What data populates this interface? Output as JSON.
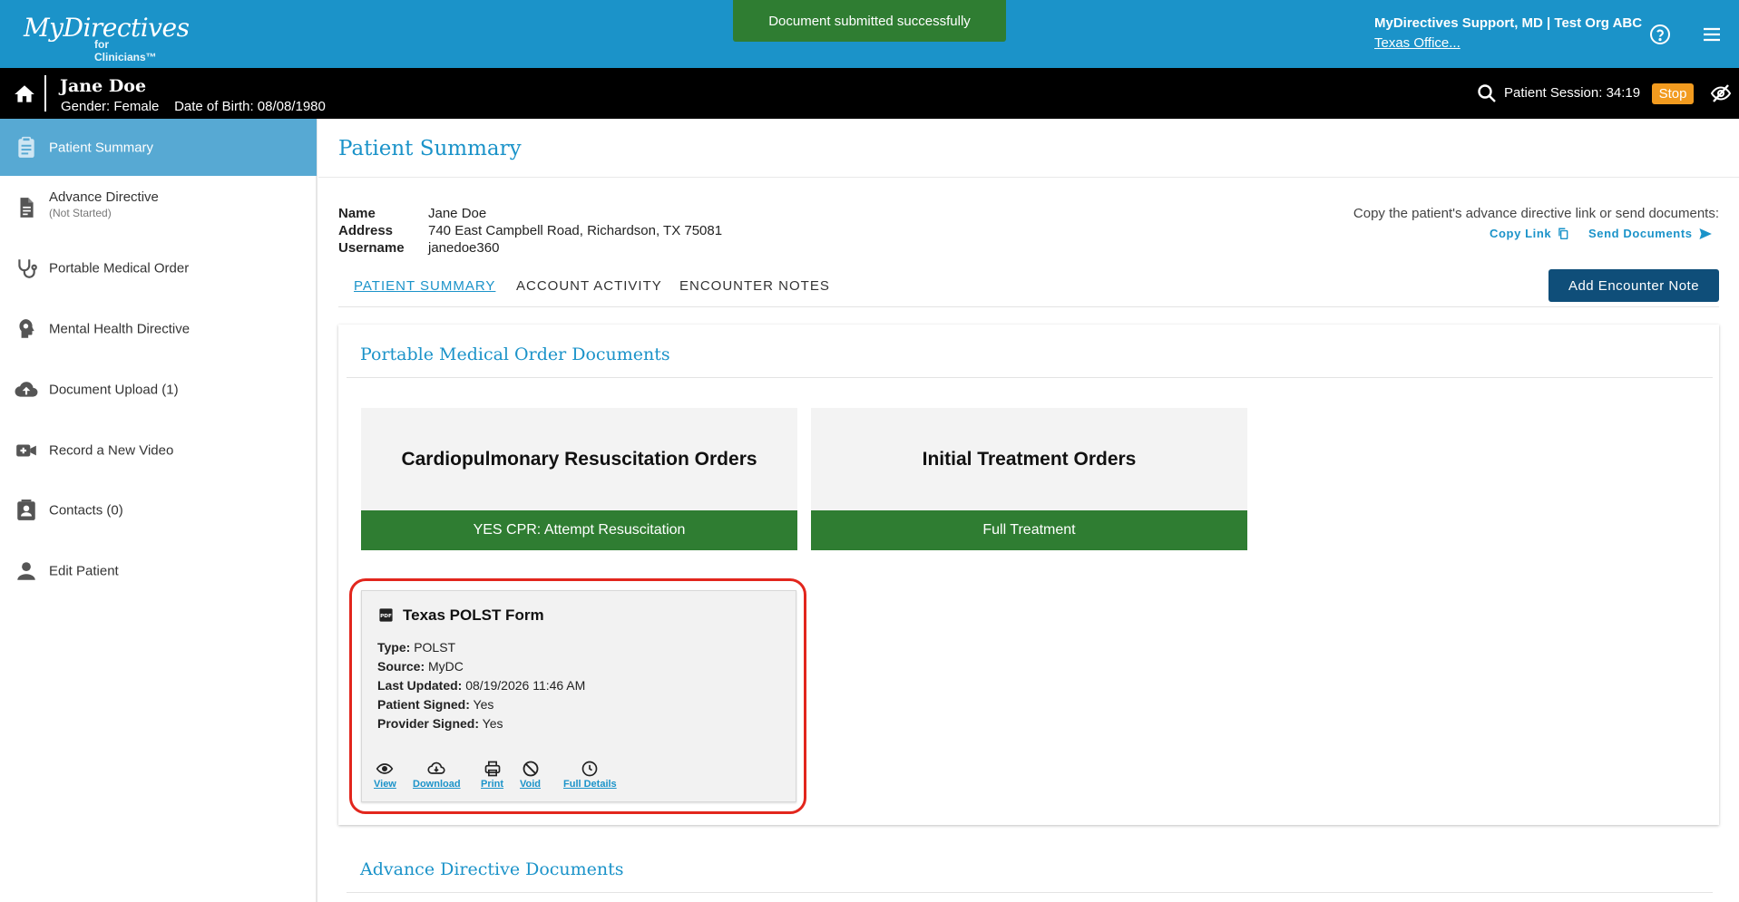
{
  "header": {
    "logo_main": "MyDirectives",
    "logo_sub": "for Clinicians™",
    "toast": "Document submitted successfully",
    "user_name": "MyDirectives Support, MD | Test Org ABC",
    "user_org": "Texas Office...",
    "help_icon": "help-circle-icon",
    "menu_icon": "hamburger-menu-icon"
  },
  "patient_bar": {
    "name": "Jane Doe",
    "gender_label": "Gender:",
    "gender": "Female",
    "dob_label": "Date of Birth:",
    "dob": "08/08/1980",
    "session_label": "Patient Session:",
    "session_time": "34:19",
    "stop_label": "Stop"
  },
  "sidebar": {
    "items": [
      {
        "label": "Patient Summary",
        "icon": "clipboard-icon",
        "active": true
      },
      {
        "label": "Advance Directive",
        "sub": "(Not Started)",
        "icon": "document-icon"
      },
      {
        "label": "Portable Medical Order",
        "icon": "stethoscope-icon"
      },
      {
        "label": "Mental Health Directive",
        "icon": "head-icon"
      },
      {
        "label": "Document Upload (1)",
        "icon": "cloud-upload-icon"
      },
      {
        "label": "Record a New Video",
        "icon": "video-add-icon"
      },
      {
        "label": "Contacts (0)",
        "icon": "contact-card-icon"
      },
      {
        "label": "Edit Patient",
        "icon": "person-icon"
      }
    ]
  },
  "main": {
    "title": "Patient Summary",
    "info": {
      "name_label": "Name",
      "name": "Jane Doe",
      "address_label": "Address",
      "address": "740 East Campbell Road, Richardson, TX 75081",
      "username_label": "Username",
      "username": "janedoe360"
    },
    "copy_text": "Copy the patient's advance directive link or send documents:",
    "copy_link": "Copy Link",
    "send_documents": "Send Documents",
    "tabs": [
      {
        "label": "PATIENT SUMMARY",
        "active": true
      },
      {
        "label": "ACCOUNT ACTIVITY"
      },
      {
        "label": "ENCOUNTER NOTES"
      }
    ],
    "add_note": "Add Encounter Note",
    "pmo_section": "Portable Medical Order Documents",
    "orders": [
      {
        "title": "Cardiopulmonary Resuscitation Orders",
        "status": "YES CPR: Attempt Resuscitation"
      },
      {
        "title": "Initial Treatment Orders",
        "status": "Full Treatment"
      }
    ],
    "document": {
      "title": "Texas POLST Form",
      "type_label": "Type:",
      "type": "POLST",
      "source_label": "Source:",
      "source": "MyDC",
      "updated_label": "Last Updated:",
      "updated": "08/19/2026 11:46 AM",
      "patient_signed_label": "Patient Signed:",
      "patient_signed": "Yes",
      "provider_signed_label": "Provider Signed:",
      "provider_signed": "Yes",
      "actions": [
        "View",
        "Download",
        "Print",
        "Void",
        "Full Details"
      ]
    },
    "ad_section": "Advance Directive Documents"
  },
  "colors": {
    "brand_blue": "#1b93c9",
    "sidebar_active": "#57a9d3",
    "success_green": "#2f7d32",
    "navy_button": "#0f4e79",
    "stop_orange": "#f29b1f",
    "highlight_red": "#e2261d"
  }
}
